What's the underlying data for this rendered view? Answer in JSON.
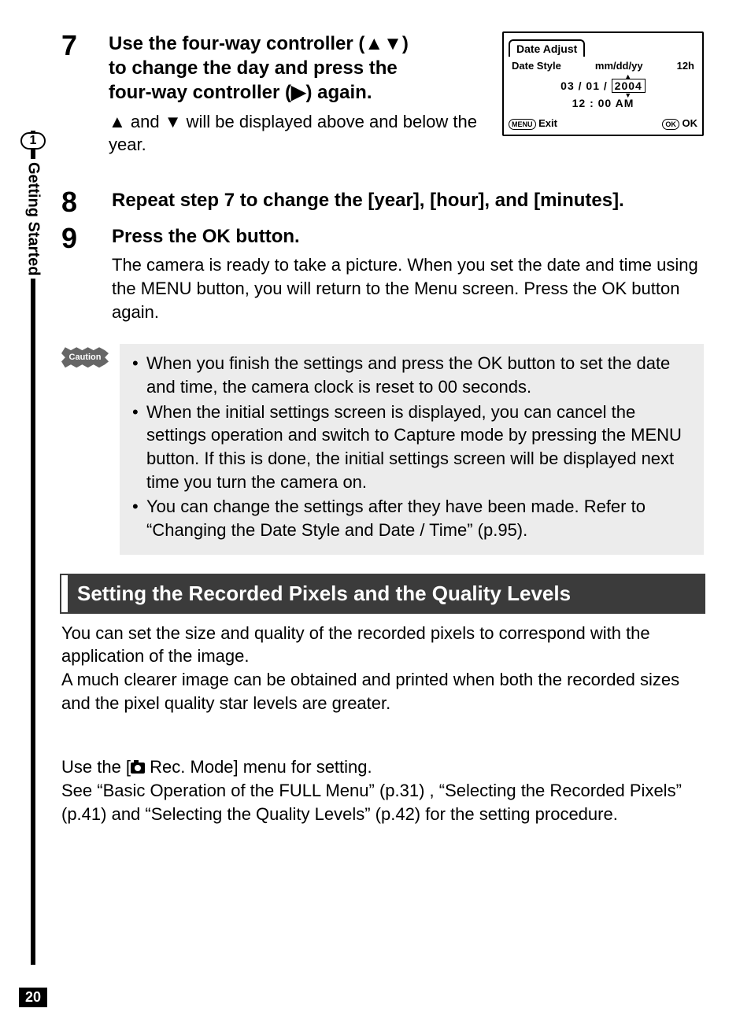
{
  "rail": {
    "chapter_num": "1",
    "chapter_label": "Getting Started"
  },
  "step7": {
    "num": "7",
    "head_l1": "Use the four-way controller (▲▼)",
    "head_l2": "to change the day and press the",
    "head_l3": "four-way controller (▶) again.",
    "body": "▲ and ▼ will be displayed above and below the year."
  },
  "screen": {
    "title": "Date Adjust",
    "style_label": "Date Style",
    "style_value": "mm/dd/yy",
    "hour_mode": "12h",
    "date_mm": "03",
    "date_sep1": "/",
    "date_dd": "01",
    "date_sep2": "/",
    "date_yy": "2004",
    "time": "12 : 00 AM",
    "menu_pill": "MENU",
    "exit": "Exit",
    "ok_pill": "OK",
    "ok": "OK"
  },
  "step8": {
    "num": "8",
    "head": "Repeat step 7 to change the [year], [hour], and [minutes]."
  },
  "step9": {
    "num": "9",
    "head": "Press the OK button.",
    "body": "The camera is ready to take a picture. When you set the date and time using the MENU button, you will return to the Menu screen. Press the OK button again."
  },
  "caution": {
    "label": "Caution",
    "items": [
      "When you finish the settings and press the OK button to set the date and time, the camera clock is reset to 00 seconds.",
      "When the initial settings screen is displayed, you can cancel the settings operation and switch to Capture mode by pressing the MENU button. If this is done, the initial settings screen will be displayed next time you turn the camera on.",
      "You can change the settings after they have been made. Refer to “Changing the Date Style and Date / Time” (p.95)."
    ]
  },
  "section_title": "Setting the Recorded Pixels and the Quality Levels",
  "para1": "You can set the size and quality of the recorded pixels to correspond with the application of the image.\nA much clearer image can be obtained and printed when both the recorded sizes and the pixel quality star levels are greater.",
  "para2_pre": "Use the [",
  "para2_post": " Rec. Mode] menu for setting.\nSee “Basic Operation of the FULL Menu” (p.31) , “Selecting the Recorded Pixels” (p.41) and “Selecting the Quality Levels” (p.42) for the setting procedure.",
  "page_number": "20"
}
